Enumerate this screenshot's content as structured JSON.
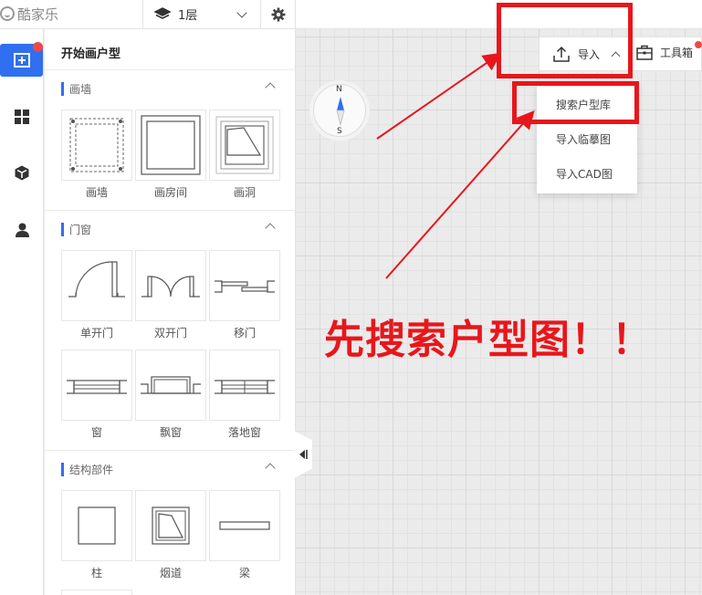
{
  "app": {
    "brand": "酷家乐"
  },
  "header": {
    "floor_label": "1层"
  },
  "panel": {
    "title": "开始画户型",
    "sections": [
      {
        "title": "画墙",
        "items": [
          "画墙",
          "画房间",
          "画洞"
        ]
      },
      {
        "title": "门窗",
        "items": [
          "单开门",
          "双开门",
          "移门",
          "窗",
          "飘窗",
          "落地窗"
        ]
      },
      {
        "title": "结构部件",
        "items": [
          "柱",
          "烟道",
          "梁"
        ]
      }
    ]
  },
  "compass": {
    "north": "N",
    "south": "S"
  },
  "toolbar": {
    "import_label": "导入",
    "tools_label": "工具箱"
  },
  "import_menu": {
    "items": [
      "搜索户型库",
      "导入临摹图",
      "导入CAD图"
    ]
  },
  "annotation": {
    "text": "先搜索户型图！！"
  },
  "colors": {
    "accent": "#2f6ff0",
    "highlight": "#e8161b",
    "badge": "#f04848"
  }
}
